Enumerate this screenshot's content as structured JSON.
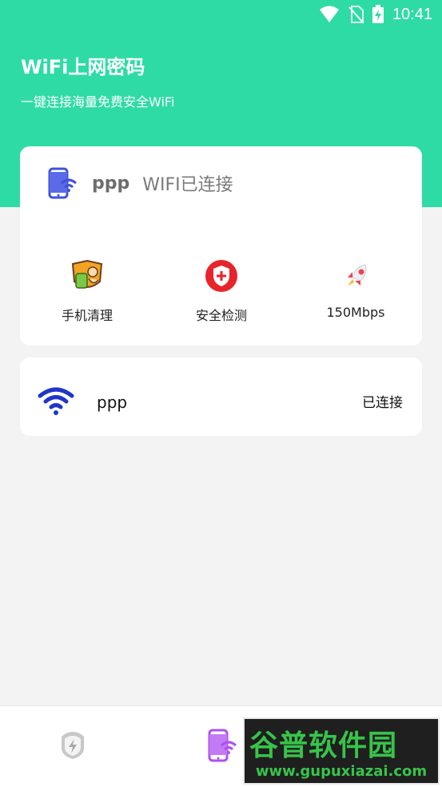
{
  "status_bar": {
    "time": "10:41"
  },
  "header": {
    "title": "WiFi上网密码",
    "subtitle": "一键连接海量免费安全WiFi"
  },
  "connection": {
    "ssid": "ppp",
    "status": "WIFI已连接"
  },
  "features": [
    {
      "label": "手机清理",
      "icon": "cleaner-icon"
    },
    {
      "label": "安全检测",
      "icon": "shield-icon"
    },
    {
      "label": "150Mbps",
      "icon": "rocket-icon"
    }
  ],
  "networks": [
    {
      "name": "ppp",
      "status": "已连接",
      "icon": "wifi-icon"
    }
  ],
  "bottom_nav": {
    "tabs": [
      {
        "icon": "security-tab-icon"
      },
      {
        "icon": "wifi-phone-tab-icon"
      }
    ]
  },
  "watermark": {
    "main": "谷普软件园",
    "url": "www.gupuxiazai.com"
  },
  "colors": {
    "header": "#2fdba5",
    "accent_blue": "#1f36c9",
    "accent_purple": "#b04ff0",
    "shield_red": "#e8242b"
  }
}
